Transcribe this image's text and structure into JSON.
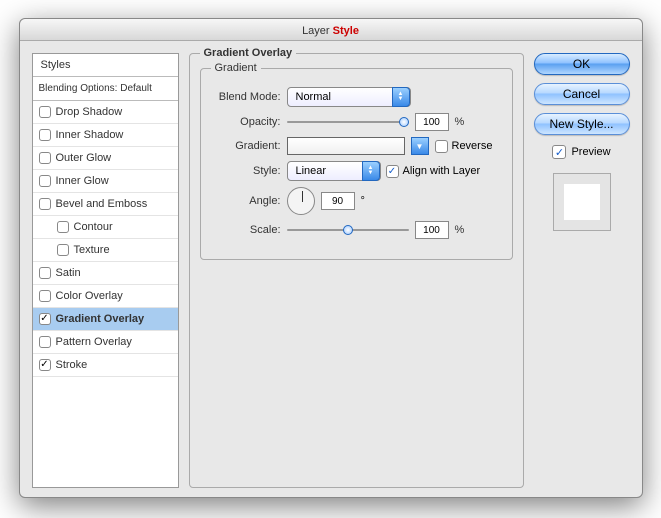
{
  "title": {
    "pre": "Layer ",
    "em": "Style",
    "post": ""
  },
  "sidebar": {
    "header": "Styles",
    "blending": "Blending Options: Default",
    "items": [
      {
        "label": "Drop Shadow",
        "checked": false
      },
      {
        "label": "Inner Shadow",
        "checked": false
      },
      {
        "label": "Outer Glow",
        "checked": false
      },
      {
        "label": "Inner Glow",
        "checked": false
      },
      {
        "label": "Bevel and Emboss",
        "checked": false
      },
      {
        "label": "Contour",
        "checked": false,
        "indent": true
      },
      {
        "label": "Texture",
        "checked": false,
        "indent": true
      },
      {
        "label": "Satin",
        "checked": false
      },
      {
        "label": "Color Overlay",
        "checked": false
      },
      {
        "label": "Gradient Overlay",
        "checked": true,
        "selected": true,
        "bold": true
      },
      {
        "label": "Pattern Overlay",
        "checked": false
      },
      {
        "label": "Stroke",
        "checked": true
      }
    ]
  },
  "main": {
    "legend": "Gradient Overlay",
    "group": "Gradient",
    "blend_mode_label": "Blend Mode:",
    "blend_mode_value": "Normal",
    "opacity_label": "Opacity:",
    "opacity_value": "100",
    "percent": "%",
    "gradient_label": "Gradient:",
    "reverse_label": "Reverse",
    "reverse_checked": false,
    "style_label": "Style:",
    "style_value": "Linear",
    "align_label": "Align with Layer",
    "align_checked": true,
    "angle_label": "Angle:",
    "angle_value": "90",
    "degree": "°",
    "scale_label": "Scale:",
    "scale_value": "100"
  },
  "right": {
    "ok": "OK",
    "cancel": "Cancel",
    "newstyle": "New Style...",
    "preview_label": "Preview",
    "preview_checked": true
  }
}
